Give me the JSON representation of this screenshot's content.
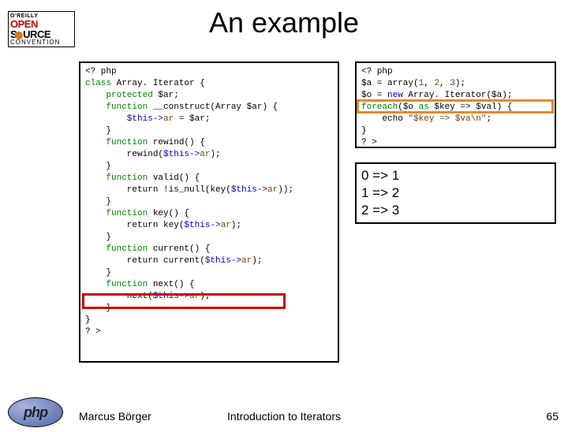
{
  "title": "An example",
  "logo": {
    "line1": "O'REILLY",
    "open": "OPEN",
    "source": "S   URCE",
    "conv": "CONVENTION"
  },
  "footer": {
    "author": "Marcus Börger",
    "subject": "Introduction to Iterators",
    "page": "65",
    "phpText": "php"
  },
  "code_left": {
    "l1": "<? php",
    "l2a": "class",
    "l2b": " Array. Iterator {",
    "l3a": "    protected",
    "l3b": " $ar;",
    "l4a": "    function",
    "l4b": " __construct(Array $ar) {",
    "l5a": "        $this",
    "l5b": "->",
    "l5c": "ar",
    "l5d": " = $ar;",
    "l6": "    }",
    "l7a": "    function",
    "l7b": " rewind() {",
    "l8a": "        rewind(",
    "l8b": "$this",
    "l8c": "->",
    "l8d": "ar",
    "l8e": ");",
    "l9": "    }",
    "l10a": "    function",
    "l10b": " valid() {",
    "l11a": "        return !is_null(key(",
    "l11b": "$this",
    "l11c": "->",
    "l11d": "ar",
    "l11e": "));",
    "l12": "    }",
    "l13a": "    function",
    "l13b": " key() {",
    "l14a": "        return key(",
    "l14b": "$this",
    "l14c": "->",
    "l14d": "ar",
    "l14e": ");",
    "l15": "    }",
    "l16a": "    function",
    "l16b": " current() {",
    "l17a": "        return current(",
    "l17b": "$this",
    "l17c": "->",
    "l17d": "ar",
    "l17e": ");",
    "l18": "    }",
    "l19a": "    function",
    "l19b": " next() {",
    "l20a": "        next(",
    "l20b": "$this",
    "l20c": "->",
    "l20d": "ar",
    "l20e": ");",
    "l21": "    }",
    "l22": "}",
    "l23": "? >"
  },
  "code_right": {
    "l1": "<? php",
    "l2a": "$a = array(",
    "l2b": "1",
    "l2c": ", ",
    "l2d": "2",
    "l2e": ", ",
    "l2f": "3",
    "l2g": ");",
    "l3a": "$o = ",
    "l3b": "new",
    "l3c": " Array. Iterator($a);",
    "l4a": "foreach",
    "l4b": "($o ",
    "l4c": "as",
    "l4d": " $key => $val) {",
    "l5a": "    echo ",
    "l5b": "\"$key => $va\\n\"",
    "l5c": ";",
    "l6": "}",
    "l7": "? >"
  },
  "output": {
    "r1": "0 => 1",
    "r2": "1 => 2",
    "r3": "2 => 3"
  }
}
